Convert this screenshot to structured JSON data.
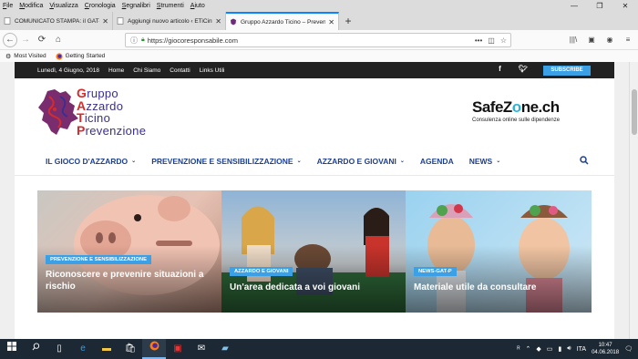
{
  "menu": [
    "File",
    "Modifica",
    "Visualizza",
    "Cronologia",
    "Segnalibri",
    "Strumenti",
    "Aiuto"
  ],
  "window_controls": {
    "minimize": "—",
    "restore": "❐",
    "close": "✕"
  },
  "tabs": [
    {
      "title": "COMUNICATO STAMPA: il GAT-P",
      "active": false
    },
    {
      "title": "Aggiungi nuovo articolo ‹ ETiCinforma",
      "active": false
    },
    {
      "title": "Gruppo Azzardo Ticino – Prevenzione",
      "active": true
    }
  ],
  "new_tab_label": "+",
  "nav": {
    "back": "←",
    "forward": "→",
    "reload": "C",
    "home": "⌂"
  },
  "urlbar": {
    "url": "https://giocoresponsabile.com",
    "menu": "•••",
    "pocket": "◫",
    "bookmark": "☆"
  },
  "right_tools": {
    "library": "|||\\",
    "sidebar": "▣",
    "account": "◉",
    "menu": "≡"
  },
  "bookmarks": [
    {
      "icon": "gear-icon",
      "label": "Most Visited"
    },
    {
      "icon": "firefox-icon",
      "label": "Getting Started"
    }
  ],
  "site": {
    "topbar": {
      "date": "Lunedì, 4 Giugno, 2018",
      "links": [
        "Home",
        "Chi Siamo",
        "Contatti",
        "Links Utili"
      ],
      "facebook": "f",
      "twitter": "t",
      "subscribe": "SUBSCRIBE"
    },
    "logo": {
      "lines": [
        {
          "initial": "G",
          "rest": "ruppo"
        },
        {
          "initial": "A",
          "rest": "zzardo"
        },
        {
          "initial": "T",
          "rest": "icino"
        },
        {
          "initial": "P",
          "rest": "revenzione"
        }
      ]
    },
    "safezone": {
      "brand_a": "SafeZ",
      "brand_o": "o",
      "brand_b": "ne.ch",
      "tagline": "Consulenza online sulle dipendenze"
    },
    "nav": [
      {
        "label": "IL GIOCO D'AZZARDO",
        "dropdown": true
      },
      {
        "label": "PREVENZIONE E SENSIBILIZZAZIONE",
        "dropdown": true
      },
      {
        "label": "AZZARDO E GIOVANI",
        "dropdown": true
      },
      {
        "label": "AGENDA",
        "dropdown": false
      },
      {
        "label": "NEWS",
        "dropdown": true
      }
    ],
    "chevron": "⌄",
    "search_icon": "search-icon",
    "cards": [
      {
        "badge": "PREVENZIONE E SENSIBILIZZAZIONE",
        "title": "Riconoscere e prevenire situazioni a rischio"
      },
      {
        "badge": "AZZARDO E GIOVANI",
        "title": "Un'area dedicata a voi giovani"
      },
      {
        "badge": "NEWS-GAT-P",
        "title": "Materiale utile da consultare"
      }
    ]
  },
  "taskbar": {
    "apps": [
      "windows-start-icon",
      "search-icon",
      "task-view-icon",
      "edge-icon",
      "file-explorer-icon",
      "store-icon",
      "firefox-icon",
      "gift-icon",
      "mail-icon",
      "app-icon"
    ],
    "lang": "ITA",
    "time": "10:47",
    "date": "04.06.2018"
  },
  "colors": {
    "accent": "#0a84ff",
    "site_blue": "#1d3f8e",
    "badge_blue": "#3ba0e6",
    "logo_red": "#d62b2b",
    "logo_purple": "#3a2f90"
  }
}
